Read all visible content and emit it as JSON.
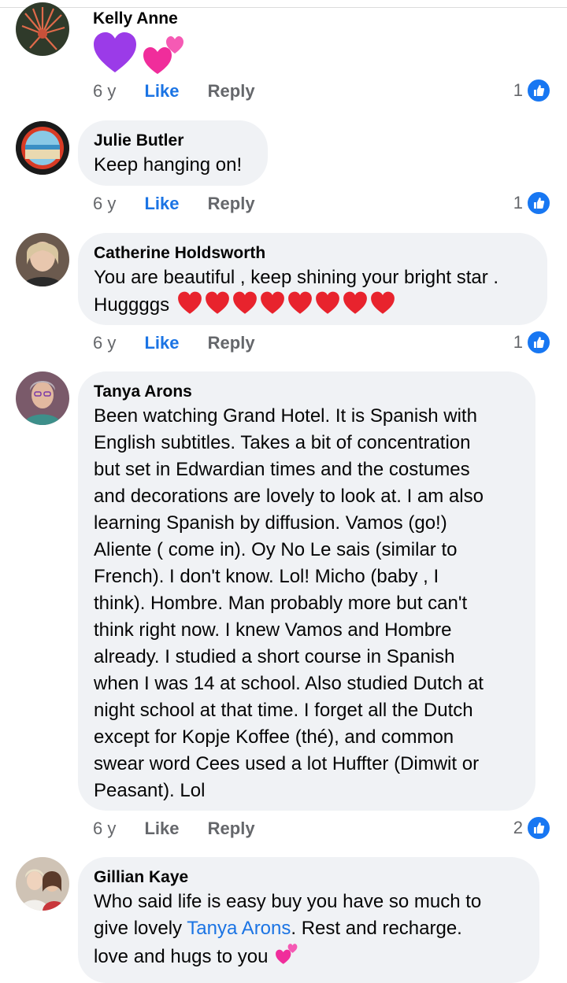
{
  "comments": [
    {
      "author": "Kelly Anne",
      "text": "",
      "emojis": [
        "purple-heart",
        "two-hearts"
      ],
      "time": "6 y",
      "like": "Like",
      "reply": "Reply",
      "reactions": "1",
      "liked": true
    },
    {
      "author": "Julie Butler",
      "text": "Keep hanging on!",
      "time": "6 y",
      "like": "Like",
      "reply": "Reply",
      "reactions": "1",
      "liked": true
    },
    {
      "author": "Catherine Holdsworth",
      "text": "You are beautiful , keep shining your bright star .",
      "text2": "Huggggs",
      "emojis": [
        "red-heart",
        "red-heart",
        "red-heart",
        "red-heart",
        "red-heart",
        "red-heart",
        "red-heart",
        "red-heart"
      ],
      "time": "6 y",
      "like": "Like",
      "reply": "Reply",
      "reactions": "1",
      "liked": true
    },
    {
      "author": "Tanya Arons",
      "lines": [
        "Been watching Grand Hotel.  It is Spanish with",
        "English subtitles.  Takes a bit of concentration",
        "but set in Edwardian times and the costumes",
        "and decorations are lovely to look at. I am also",
        "learning Spanish by diffusion.  Vamos (go!)",
        "Aliente ( come in). Oy No Le sais (similar to",
        "French). I don't know.  Lol!  Micho (baby , I",
        "think). Hombre.  Man probably more but can't",
        "think right now.  I knew Vamos and Hombre",
        "already.  I studied a short course in Spanish",
        "when I was 14 at school.  Also studied Dutch at",
        "night school at that time.  I forget all the Dutch",
        "except for Kopje Koffee (thé), and common",
        "swear word Cees used a lot Huffter (Dimwit or",
        "Peasant). Lol"
      ],
      "time": "6 y",
      "like": "Like",
      "reply": "Reply",
      "reactions": "2",
      "liked": false
    },
    {
      "author": "Gillian Kaye",
      "line1": "Who said  life is easy  buy you have  so much to",
      "line2_pre": "give  lovely ",
      "mention": "Tanya Arons",
      "line2_post": ".  Rest and  recharge.",
      "line3": "love  and hugs to you ",
      "emojis": [
        "two-hearts"
      ]
    }
  ],
  "colors": {
    "bubble": "#f0f2f5",
    "accent": "#1b74e4",
    "meta": "#65676b"
  }
}
